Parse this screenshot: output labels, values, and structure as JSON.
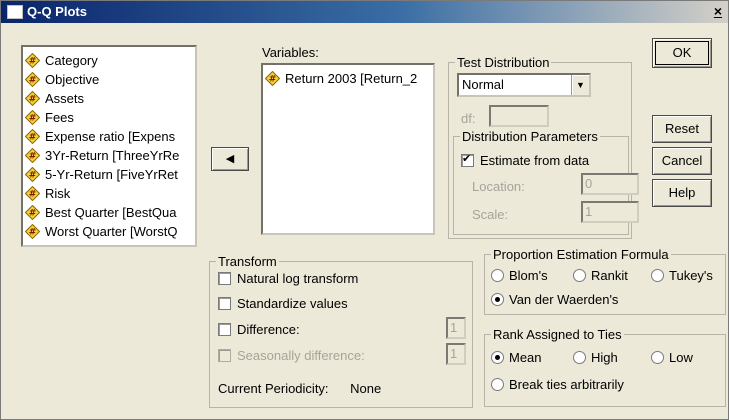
{
  "window": {
    "title": "Q-Q Plots",
    "close_glyph": "×"
  },
  "source_variables": [
    "Category",
    "Objective",
    "Assets",
    "Fees",
    "Expense ratio [Expens",
    "3Yr-Return [ThreeYrRe",
    "5-Yr-Return [FiveYrRet",
    "Risk",
    "Best Quarter [BestQua",
    "Worst Quarter [WorstQ"
  ],
  "move_button_glyph": "◀",
  "variables": {
    "label": "Variables:",
    "items": [
      "Return 2003 [Return_2"
    ]
  },
  "test_distribution": {
    "legend": "Test Distribution",
    "selected": "Normal",
    "df_label": "df:",
    "df_value": ""
  },
  "distribution_parameters": {
    "legend": "Distribution Parameters",
    "estimate_label": "Estimate from data",
    "estimate_checked": true,
    "location_label": "Location:",
    "location_value": "0",
    "scale_label": "Scale:",
    "scale_value": "1"
  },
  "buttons": {
    "ok": "OK",
    "reset": "Reset",
    "cancel": "Cancel",
    "help": "Help"
  },
  "transform": {
    "legend": "Transform",
    "natural_log": "Natural log transform",
    "standardize": "Standardize values",
    "difference": "Difference:",
    "difference_value": "1",
    "seasonal": "Seasonally difference:",
    "seasonal_value": "1",
    "periodicity_label": "Current Periodicity:",
    "periodicity_value": "None"
  },
  "proportion_formula": {
    "legend": "Proportion Estimation Formula",
    "options": [
      "Blom's",
      "Rankit",
      "Tukey's",
      "Van der Waerden's"
    ],
    "selected": "Van der Waerden's"
  },
  "rank_ties": {
    "legend": "Rank Assigned to Ties",
    "options": [
      "Mean",
      "High",
      "Low",
      "Break ties arbitrarily"
    ],
    "selected": "Mean"
  }
}
